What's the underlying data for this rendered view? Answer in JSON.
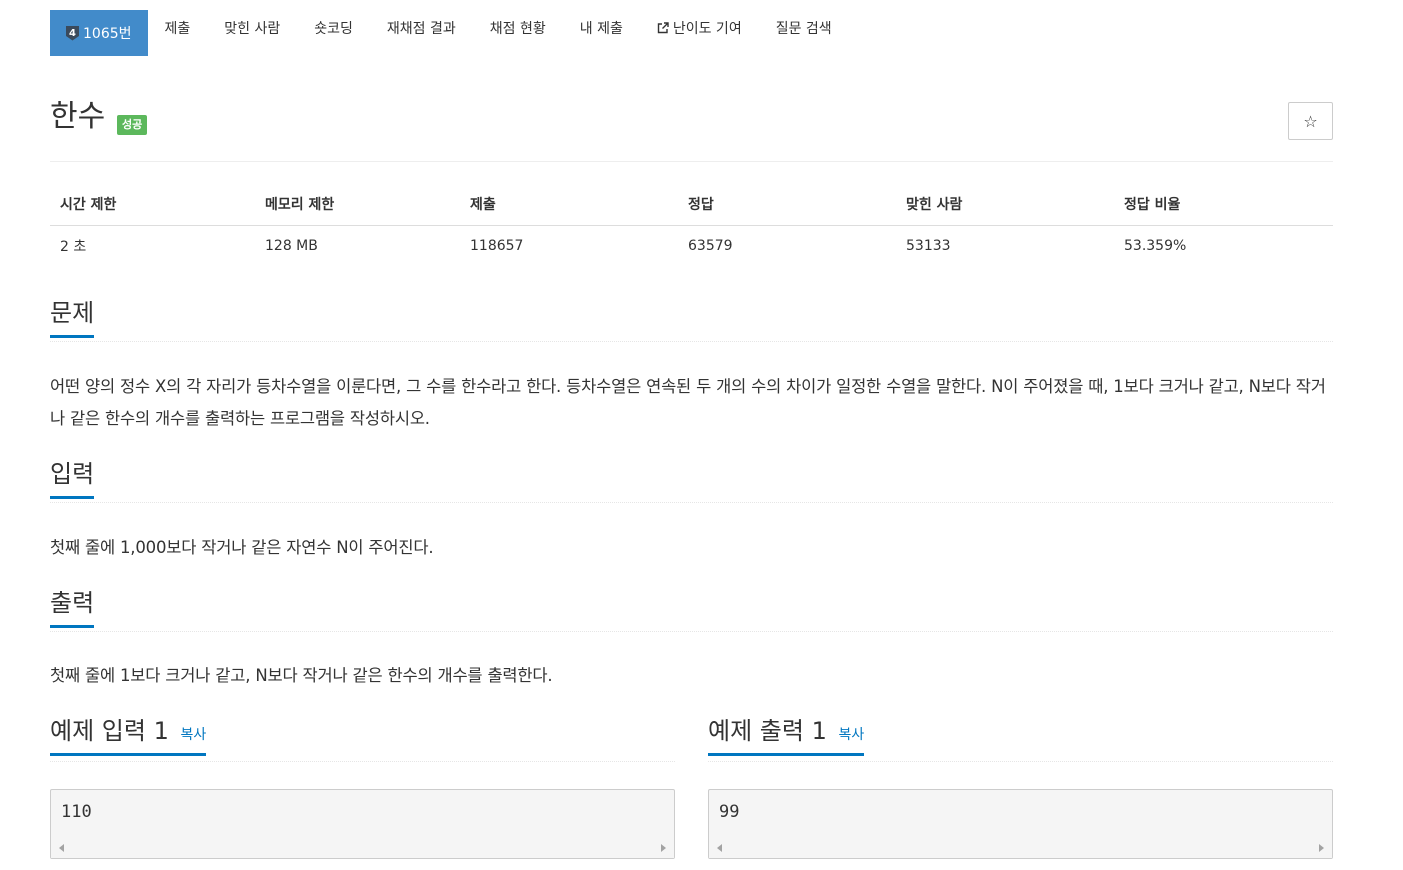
{
  "nav": {
    "tier": "4",
    "problem_tab": "1065번",
    "tabs": [
      "제출",
      "맞힌 사람",
      "숏코딩",
      "재채점 결과",
      "채점 현황",
      "내 제출",
      "난이도 기여",
      "질문 검색"
    ]
  },
  "title": "한수",
  "status_badge": "성공",
  "star_icon": "☆",
  "info": {
    "headers": [
      "시간 제한",
      "메모리 제한",
      "제출",
      "정답",
      "맞힌 사람",
      "정답 비율"
    ],
    "values": [
      "2 초",
      "128 MB",
      "118657",
      "63579",
      "53133",
      "53.359%"
    ]
  },
  "sections": {
    "problem": {
      "heading": "문제",
      "text": "어떤 양의 정수 X의 각 자리가 등차수열을 이룬다면, 그 수를 한수라고 한다. 등차수열은 연속된 두 개의 수의 차이가 일정한 수열을 말한다. N이 주어졌을 때, 1보다 크거나 같고, N보다 작거나 같은 한수의 개수를 출력하는 프로그램을 작성하시오."
    },
    "input": {
      "heading": "입력",
      "text": "첫째 줄에 1,000보다 작거나 같은 자연수 N이 주어진다."
    },
    "output": {
      "heading": "출력",
      "text": "첫째 줄에 1보다 크거나 같고, N보다 작거나 같은 한수의 개수를 출력한다."
    }
  },
  "samples": {
    "input": {
      "heading": "예제 입력 1",
      "copy": "복사",
      "value": "110"
    },
    "output": {
      "heading": "예제 출력 1",
      "copy": "복사",
      "value": "99"
    }
  },
  "colors": {
    "primary": "#428bca",
    "success": "#5cb85c",
    "accent": "#0076c0"
  }
}
